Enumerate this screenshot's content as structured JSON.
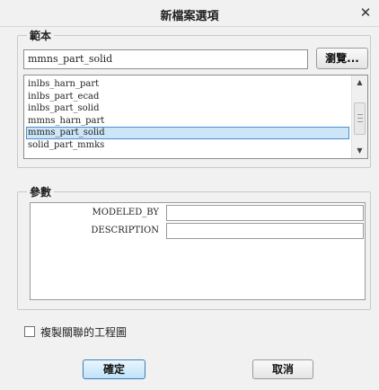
{
  "dialog": {
    "title": "新檔案選項"
  },
  "template": {
    "label": "範本",
    "value": "mmns_part_solid",
    "browse_label": "瀏覽...",
    "items": [
      {
        "label": "inlbs_harn_part",
        "selected": false
      },
      {
        "label": "inlbs_part_ecad",
        "selected": false
      },
      {
        "label": "inlbs_part_solid",
        "selected": false
      },
      {
        "label": "mmns_harn_part",
        "selected": false
      },
      {
        "label": "mmns_part_solid",
        "selected": true
      },
      {
        "label": "solid_part_mmks",
        "selected": false
      }
    ]
  },
  "parameters": {
    "label": "參數",
    "rows": [
      {
        "name": "MODELED_BY",
        "value": ""
      },
      {
        "name": "DESCRIPTION",
        "value": ""
      }
    ]
  },
  "copy_drawing": {
    "label": "複製關聯的工程圖",
    "checked": false
  },
  "actions": {
    "ok_label": "確定",
    "cancel_label": "取消"
  },
  "icons": {
    "close": "close-icon",
    "scroll_up": "arrow-up-icon",
    "scroll_down": "arrow-down-icon"
  }
}
